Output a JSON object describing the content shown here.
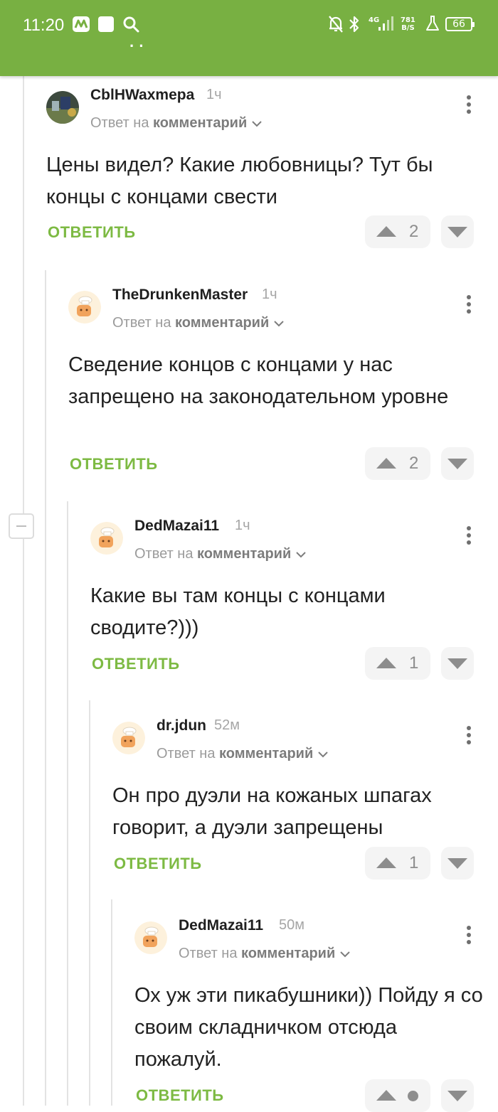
{
  "status_bar": {
    "time": "11:20",
    "network": "4G",
    "speed_value": "781",
    "speed_unit": "B/S",
    "battery": "66",
    "icons": [
      "app-notification-icon",
      "white-square-icon",
      "search-icon",
      "mute-icon",
      "bluetooth-icon",
      "signal-icon",
      "flask-icon",
      "battery-icon"
    ]
  },
  "colors": {
    "header_green": "#78b042",
    "reply_link_green": "#7dba43",
    "text": "#222222",
    "muted": "#9b9b9b"
  },
  "comments": [
    {
      "username": "CblHWaxmepa",
      "time": "1ч",
      "reply_prefix": "Ответ на",
      "reply_target": "комментарий",
      "text": "Цены видел? Какие любовницы? Тут бы концы с концами свести",
      "reply_label": "ОТВЕТИТЬ",
      "votes": "2",
      "avatar": "photo"
    },
    {
      "username": "TheDrunkenMaster",
      "time": "1ч",
      "reply_prefix": "Ответ на",
      "reply_target": "комментарий",
      "text": "Сведение концов с концами у нас запрещено на законодательном уровне",
      "reply_label": "ОТВЕТИТЬ",
      "votes": "2",
      "avatar": "default-chef"
    },
    {
      "username": "DedMazai11",
      "time": "1ч",
      "reply_prefix": "Ответ на",
      "reply_target": "комментарий",
      "text": "Какие вы там концы с концами сводите?)))",
      "reply_label": "ОТВЕТИТЬ",
      "votes": "1",
      "avatar": "default-chef"
    },
    {
      "username": "dr.jdun",
      "time": "52м",
      "reply_prefix": "Ответ на",
      "reply_target": "комментарий",
      "text": "Он про дуэли на кожаных шпагах говорит, а дуэли запрещены",
      "reply_label": "ОТВЕТИТЬ",
      "votes": "1",
      "avatar": "default-chef"
    },
    {
      "username": "DedMazai11",
      "time": "50м",
      "reply_prefix": "Ответ на",
      "reply_target": "комментарий",
      "text": "Ох уж эти пикабушники)) Пойду я со своим складничком отсюда пожалуй.",
      "reply_label": "ОТВЕТИТЬ",
      "votes": "",
      "avatar": "default-chef"
    }
  ]
}
